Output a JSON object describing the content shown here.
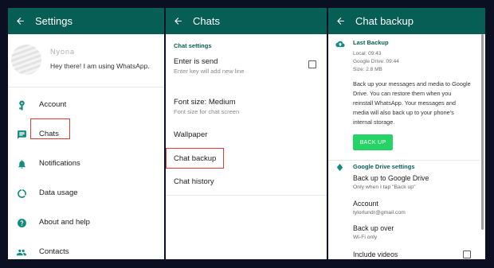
{
  "settings_screen": {
    "title": "Settings",
    "profile": {
      "name": "Nyona",
      "status": "Hey there! I am using WhatsApp."
    },
    "items": [
      {
        "label": "Account",
        "icon": "key-icon"
      },
      {
        "label": "Chats",
        "icon": "chat-icon"
      },
      {
        "label": "Notifications",
        "icon": "bell-icon"
      },
      {
        "label": "Data usage",
        "icon": "data-usage-icon"
      },
      {
        "label": "About and help",
        "icon": "help-icon"
      },
      {
        "label": "Contacts",
        "icon": "contacts-icon"
      }
    ]
  },
  "chats_screen": {
    "title": "Chats",
    "section_header": "Chat settings",
    "enter_is_send": {
      "title": "Enter is send",
      "subtitle": "Enter key will add new line"
    },
    "font_size": {
      "title": "Font size: Medium",
      "subtitle": "Font size for chat screen"
    },
    "wallpaper": {
      "title": "Wallpaper"
    },
    "chat_backup": {
      "title": "Chat backup"
    },
    "chat_history": {
      "title": "Chat history"
    }
  },
  "backup_screen": {
    "title": "Chat backup",
    "last_backup": {
      "header": "Last Backup",
      "local": "Local: 09:43",
      "google_drive": "Google Drive: 09:44",
      "size": "Size: 2.8 MB"
    },
    "description": "Back up your messages and media to Google Drive. You can restore them when you reinstall WhatsApp. Your messages and media will also back up to your phone's internal storage.",
    "backup_button": "BACK UP",
    "drive_settings": {
      "header": "Google Drive settings",
      "backup_to_drive": {
        "title": "Back up to Google Drive",
        "subtitle": "Only when I tap \"Back up\""
      },
      "account": {
        "title": "Account",
        "subtitle": "tylorlundr@gmail.com"
      },
      "backup_over": {
        "title": "Back up over",
        "subtitle": "Wi-Fi only"
      },
      "include_videos": {
        "title": "Include videos"
      }
    }
  },
  "colors": {
    "appbar": "#075e54",
    "accent": "#25d366",
    "highlight": "#e53935"
  }
}
